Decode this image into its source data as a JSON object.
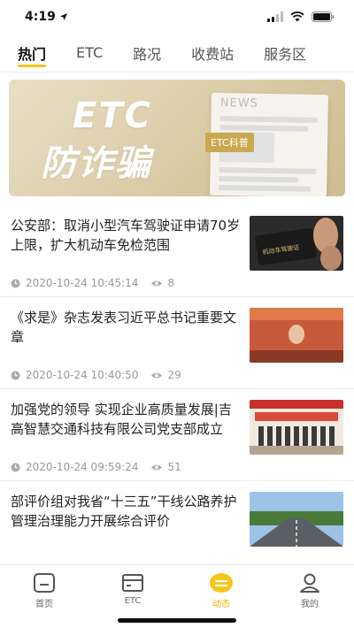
{
  "status_bar": {
    "time": "4:19"
  },
  "tabs": [
    {
      "label": "热门",
      "active": true
    },
    {
      "label": "ETC",
      "active": false
    },
    {
      "label": "路况",
      "active": false
    },
    {
      "label": "收费站",
      "active": false
    },
    {
      "label": "服务区",
      "active": false
    }
  ],
  "banner": {
    "headline": "ETC",
    "subheadline": "防诈骗",
    "paper_word": "NEWS",
    "tag": "ETC科普"
  },
  "news": [
    {
      "title": "公安部：取消小型汽车驾驶证申请70岁上限，扩大机动车免检范围",
      "date": "2020-10-24 10:45:14",
      "views": "8",
      "thumb_text": "机动车驾驶证"
    },
    {
      "title": "《求是》杂志发表习近平总书记重要文章",
      "date": "2020-10-24 10:40:50",
      "views": "29"
    },
    {
      "title": "加强党的领导 实现企业高质量发展|吉高智慧交通科技有限公司党支部成立",
      "date": "2020-10-24 09:59:24",
      "views": "51"
    },
    {
      "title": "部评价组对我省“十三五”干线公路养护管理治理能力开展综合评价",
      "date": "",
      "views": ""
    }
  ],
  "bottom_nav": [
    {
      "label": "首页",
      "icon": "home-icon",
      "active": false
    },
    {
      "label": "ETC",
      "icon": "etc-card-icon",
      "active": false
    },
    {
      "label": "动态",
      "icon": "news-feed-icon",
      "active": true
    },
    {
      "label": "我的",
      "icon": "profile-icon",
      "active": false
    }
  ],
  "colors": {
    "accent": "#f5c518",
    "active_nav": "#e9b400",
    "meta_gray": "#999999"
  }
}
